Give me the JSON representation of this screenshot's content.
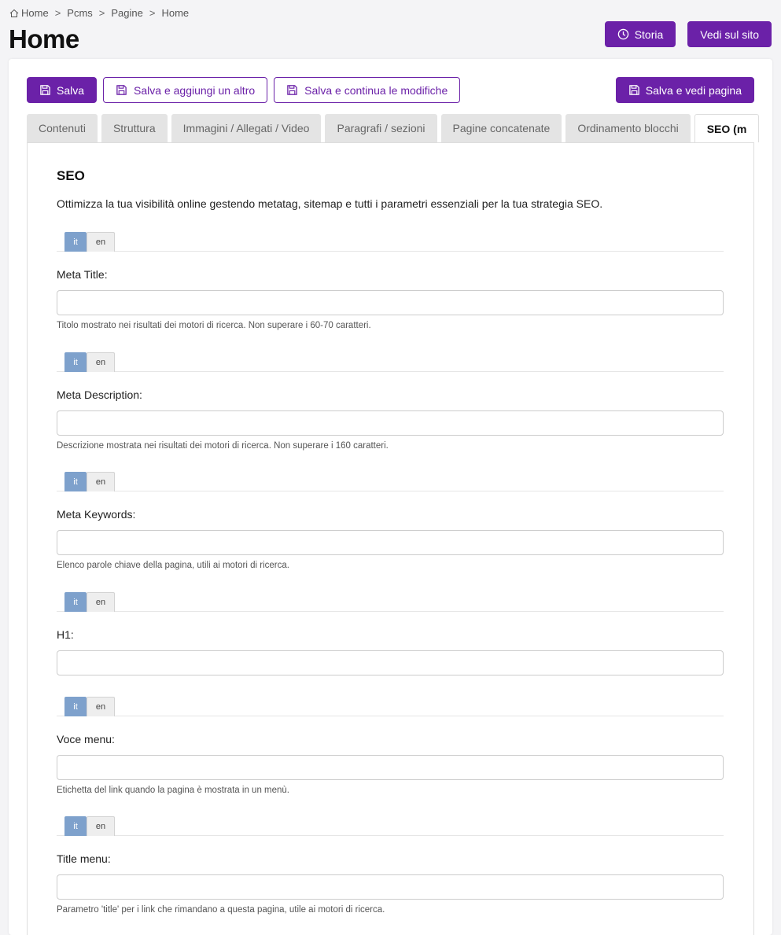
{
  "breadcrumb": [
    "Home",
    "Pcms",
    "Pagine",
    "Home"
  ],
  "page_title": "Home",
  "header_actions": {
    "history": "Storia",
    "view_site": "Vedi sul sito"
  },
  "toolbar": {
    "save": "Salva",
    "save_add": "Salva e aggiungi un altro",
    "save_continue": "Salva e continua le modifiche",
    "save_view": "Salva e vedi pagina"
  },
  "tabs": [
    "Contenuti",
    "Struttura",
    "Immagini / Allegati / Video",
    "Paragrafi / sezioni",
    "Pagine concatenate",
    "Ordinamento blocchi",
    "SEO (m"
  ],
  "seo": {
    "title": "SEO",
    "description": "Ottimizza la tua visibilità online gestendo metatag, sitemap e tutti i parametri essenziali per la tua strategia SEO."
  },
  "languages": [
    "it",
    "en"
  ],
  "fields": [
    {
      "label": "Meta Title:",
      "value": "",
      "help": "Titolo mostrato nei risultati dei motori di ricerca. Non superare i 60-70 caratteri."
    },
    {
      "label": "Meta Description:",
      "value": "",
      "help": "Descrizione mostrata nei risultati dei motori di ricerca. Non superare i 160 caratteri."
    },
    {
      "label": "Meta Keywords:",
      "value": "",
      "help": "Elenco parole chiave della pagina, utili ai motori di ricerca."
    },
    {
      "label": "H1:",
      "value": "",
      "help": ""
    },
    {
      "label": "Voce menu:",
      "value": "",
      "help": "Etichetta del link quando la pagina è mostrata in un menù."
    },
    {
      "label": "Title menu:",
      "value": "",
      "help": "Parametro 'title' per i link che rimandano a questa pagina, utile ai motori di ricerca."
    }
  ],
  "colors": {
    "primary": "#6b21a8",
    "lang_active": "#7ea1cc"
  }
}
